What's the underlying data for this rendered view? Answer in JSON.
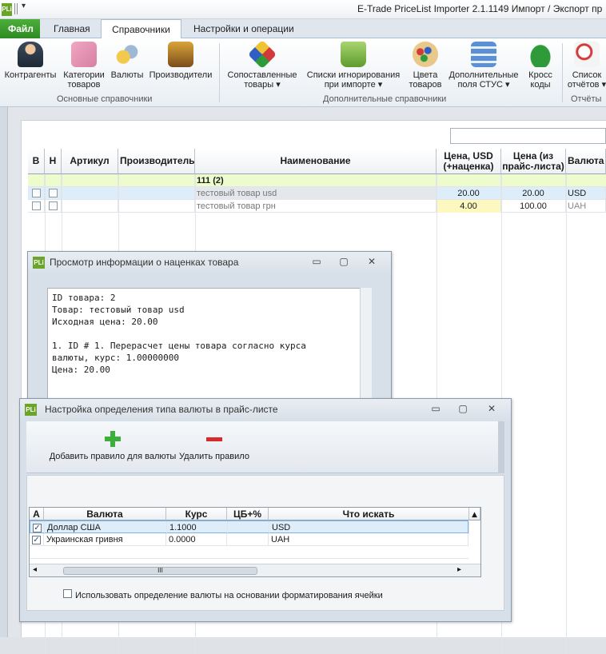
{
  "titlebar": {
    "logo": "PLi",
    "qa_arrow": "▾",
    "title": "E-Trade PriceList Importer 2.1.1149    Импорт / Экспорт пр"
  },
  "tabs": {
    "file": "Файл",
    "main": "Главная",
    "dictionaries": "Справочники",
    "settings": "Настройки и операции"
  },
  "ribbon": {
    "buttons": [
      {
        "label": "Контрагенты",
        "icon": "contractors-icon"
      },
      {
        "label": "Категории\nтоваров",
        "icon": "categories-icon"
      },
      {
        "label": "Валюты",
        "icon": "currencies-icon"
      },
      {
        "label": "Производители",
        "icon": "manufacturers-icon"
      },
      {
        "label": "Сопоставленные\nтовары ▾",
        "icon": "matched-goods-icon"
      },
      {
        "label": "Списки игнорирования\nпри импорте ▾",
        "icon": "ignore-lists-icon"
      },
      {
        "label": "Цвета\nтоваров",
        "icon": "colors-icon"
      },
      {
        "label": "Дополнительные\nполя СТУС ▾",
        "icon": "extra-fields-icon"
      },
      {
        "label": "Кросс\nкоды",
        "icon": "cross-codes-icon"
      },
      {
        "label": "Список\nотчётов ▾",
        "icon": "reports-icon"
      }
    ],
    "groups": {
      "basic": "Основные справочники",
      "additional": "Дополнительные справочники",
      "reports": "Отчёты"
    }
  },
  "grid": {
    "headers": {
      "b": "В",
      "n": "Н",
      "article": "Артикул",
      "manufacturer": "Производитель",
      "name": "Наименование",
      "price_usd": "Цена, USD (+наценка)",
      "price_list": "Цена (из прайс-листа)",
      "currency": "Валюта"
    },
    "group_row": "111 (2)",
    "rows": [
      {
        "name": "тестовый товар usd",
        "price_usd": "20.00",
        "price_list": "20.00",
        "currency": "USD"
      },
      {
        "name": "тестовый товар грн",
        "price_usd": "4.00",
        "price_list": "100.00",
        "currency": "UAH"
      }
    ]
  },
  "markup_window": {
    "title": "Просмотр информации о наценках товара",
    "minimize": "▭",
    "restore": "▢",
    "close": "✕",
    "text": "ID товара: 2\nТовар: тестовый товар usd\nИсходная цена: 20.00\n\n1. ID # 1. Перерасчет цены товара согласно курса\nвалюты, курс: 1.00000000\nЦена: 20.00"
  },
  "currency_window": {
    "title": "Настройка определения типа валюты в прайс-листе",
    "minimize": "▭",
    "restore": "▢",
    "close": "✕",
    "add_rule": "Добавить правило для валюты",
    "delete_rule": "Удалить правило",
    "grid_headers": {
      "a": "А",
      "currency": "Валюта",
      "rate": "Курс",
      "cb": "ЦБ+%",
      "search": "Что искать"
    },
    "rows": [
      {
        "checked": "✓",
        "currency": "Доллар США",
        "rate": "1.1000",
        "cb": "",
        "search": "USD"
      },
      {
        "checked": "✓",
        "currency": "Украинская гривня",
        "rate": "0.0000",
        "cb": "",
        "search": "UAH"
      }
    ],
    "scroll_grip": "III",
    "use_formatting": "Использовать определение валюты на основании форматирования ячейки"
  }
}
